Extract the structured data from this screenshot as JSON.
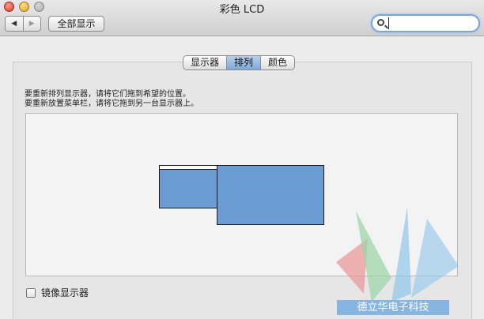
{
  "window": {
    "title": "彩色 LCD"
  },
  "toolbar": {
    "back_glyph": "◀",
    "forward_glyph": "▶",
    "show_all_label": "全部显示",
    "search": {
      "value": "",
      "placeholder": ""
    }
  },
  "tabs": [
    {
      "label": "显示器",
      "active": false
    },
    {
      "label": "排列",
      "active": true
    },
    {
      "label": "颜色",
      "active": false
    }
  ],
  "instructions": {
    "line1": "要重新排列显示器，请将它们拖到希望的位置。",
    "line2": "要重新放置菜单栏，请将它拖到另一台显示器上。"
  },
  "arrangement": {
    "displays": [
      {
        "name": "primary-display",
        "has_menubar": true
      },
      {
        "name": "secondary-display",
        "has_menubar": false
      }
    ],
    "display_color": "#6a9bd3"
  },
  "mirror": {
    "label": "镜像显示器",
    "checked": false
  },
  "watermark": {
    "text": "德立华电子科技"
  }
}
